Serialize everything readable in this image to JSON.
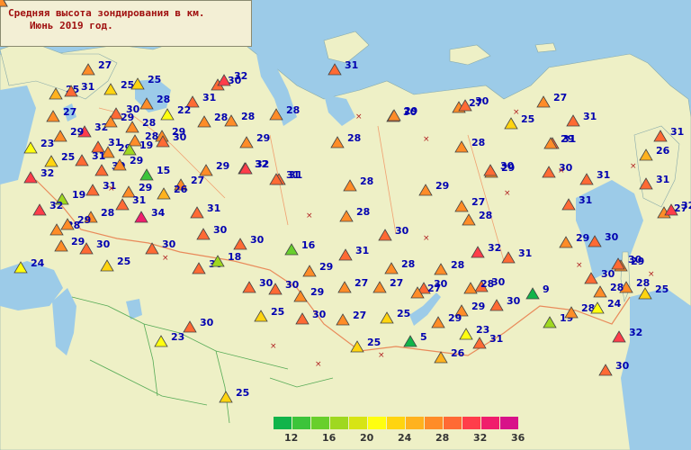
{
  "title": {
    "line1": "Средняя высота зондирования в км.",
    "line2": "Июнь 2019 год."
  },
  "colors": {
    "sea": "#9ccbe8",
    "land": "#eef0c6",
    "border": "#e98a5a",
    "label": "#0000b0"
  },
  "legend": {
    "colors": [
      "#11b44a",
      "#3cc43a",
      "#68cf2c",
      "#9fd820",
      "#d7e414",
      "#fffe10",
      "#ffd410",
      "#ffb21e",
      "#ff8c28",
      "#ff6a34",
      "#ff3d4a",
      "#f01e6c",
      "#d81289"
    ],
    "labels": [
      "12",
      "16",
      "20",
      "24",
      "28",
      "32",
      "36"
    ]
  },
  "stations": [
    {
      "v": "27",
      "c": "#ff8c28"
    },
    {
      "v": "25",
      "c": "#ffb21e"
    },
    {
      "v": "25",
      "c": "#ffd410"
    },
    {
      "v": "30",
      "c": "#ff6a34"
    },
    {
      "v": "32",
      "c": "#ff3d4a"
    },
    {
      "v": "31",
      "c": "#ff6a34"
    },
    {
      "v": "25",
      "c": "#ffd410"
    },
    {
      "v": "31",
      "c": "#ff6a34"
    },
    {
      "v": "27",
      "c": "#ff8c28"
    },
    {
      "v": "30",
      "c": "#ff6a34"
    },
    {
      "v": "28",
      "c": "#ff8c28"
    },
    {
      "v": "22",
      "c": "#fffe10"
    },
    {
      "v": "28",
      "c": "#ff8c28"
    },
    {
      "v": "28",
      "c": "#ff8c28"
    },
    {
      "v": "28",
      "c": "#ff8c28"
    },
    {
      "v": "30",
      "c": "#ff6a34"
    },
    {
      "v": "27",
      "c": "#ff8c28"
    },
    {
      "v": "32",
      "c": "#ff3d4a"
    },
    {
      "v": "29",
      "c": "#ff8c28"
    },
    {
      "v": "28",
      "c": "#ff8c28"
    },
    {
      "v": "23",
      "c": "#fffe10"
    },
    {
      "v": "31",
      "c": "#ff6a34"
    },
    {
      "v": "28",
      "c": "#ff8c28"
    },
    {
      "v": "29",
      "c": "#ff8c28"
    },
    {
      "v": "30",
      "c": "#ff6a34"
    },
    {
      "v": "29",
      "c": "#ff8c28"
    },
    {
      "v": "28",
      "c": "#ff8c28"
    },
    {
      "v": "29",
      "c": "#ff8c28"
    },
    {
      "v": "29",
      "c": "#ff8c28"
    },
    {
      "v": "19",
      "c": "#9fd820"
    },
    {
      "v": "25",
      "c": "#ffd410"
    },
    {
      "v": "31",
      "c": "#ff6a34"
    },
    {
      "v": "30",
      "c": "#ff6a34"
    },
    {
      "v": "29",
      "c": "#ff8c28"
    },
    {
      "v": "15",
      "c": "#3cc43a"
    },
    {
      "v": "32",
      "c": "#ff3d4a"
    },
    {
      "v": "29",
      "c": "#ff8c28"
    },
    {
      "v": "32",
      "c": "#ff3d4a"
    },
    {
      "v": "27",
      "c": "#ff8c28"
    },
    {
      "v": "31",
      "c": "#ff6a34"
    },
    {
      "v": "19",
      "c": "#9fd820"
    },
    {
      "v": "31",
      "c": "#ff6a34"
    },
    {
      "v": "26",
      "c": "#ffb21e"
    },
    {
      "v": "29",
      "c": "#ff8c28"
    },
    {
      "v": "28",
      "c": "#ff8c28"
    },
    {
      "v": "32",
      "c": "#ff3d4a"
    },
    {
      "v": "31",
      "c": "#ff6a34"
    },
    {
      "v": "28",
      "c": "#ff8c28"
    },
    {
      "v": "34",
      "c": "#f01e6c"
    },
    {
      "v": "29",
      "c": "#ff8c28"
    },
    {
      "v": "31",
      "c": "#ff6a34"
    },
    {
      "v": "30",
      "c": "#ff6a34"
    },
    {
      "v": "28",
      "c": "#ff8c28"
    },
    {
      "v": "29",
      "c": "#ff8c28"
    },
    {
      "v": "32",
      "c": "#ff3d4a"
    },
    {
      "v": "31",
      "c": "#ff6a34"
    },
    {
      "v": "31",
      "c": "#ff6a34"
    },
    {
      "v": "30",
      "c": "#ff6a34"
    },
    {
      "v": "29",
      "c": "#ff8c28"
    },
    {
      "v": "31",
      "c": "#ff6a34"
    },
    {
      "v": "31",
      "c": "#ff6a34"
    },
    {
      "v": "30",
      "c": "#ff6a34"
    },
    {
      "v": "16",
      "c": "#68cf2c"
    },
    {
      "v": "31",
      "c": "#ff6a34"
    },
    {
      "v": "30",
      "c": "#ff6a34"
    },
    {
      "v": "30",
      "c": "#ff6a34"
    },
    {
      "v": "32",
      "c": "#ff3d4a"
    },
    {
      "v": "30",
      "c": "#ff6a34"
    },
    {
      "v": "28",
      "c": "#ff8c28"
    },
    {
      "v": "28",
      "c": "#ff8c28"
    },
    {
      "v": "18",
      "c": "#9fd820"
    },
    {
      "v": "24",
      "c": "#fffe10"
    },
    {
      "v": "29",
      "c": "#ff8c28"
    },
    {
      "v": "25",
      "c": "#ffd410"
    },
    {
      "v": "30",
      "c": "#ff6a34"
    },
    {
      "v": "30",
      "c": "#ff6a34"
    },
    {
      "v": "28",
      "c": "#ff8c28"
    },
    {
      "v": "31",
      "c": "#ff6a34"
    },
    {
      "v": "29",
      "c": "#ff8c28"
    },
    {
      "v": "30",
      "c": "#ff6a34"
    },
    {
      "v": "27",
      "c": "#ff8c28"
    },
    {
      "v": "28",
      "c": "#ff8c28"
    },
    {
      "v": "30",
      "c": "#ff6a34"
    },
    {
      "v": "30",
      "c": "#ff6a34"
    },
    {
      "v": "30",
      "c": "#ff6a34"
    },
    {
      "v": "29",
      "c": "#ff8c28"
    },
    {
      "v": "27",
      "c": "#ff8c28"
    },
    {
      "v": "27",
      "c": "#ff8c28"
    },
    {
      "v": "28",
      "c": "#ff8c28"
    },
    {
      "v": "29",
      "c": "#ff8c28"
    },
    {
      "v": "30",
      "c": "#ff6a34"
    },
    {
      "v": "9",
      "c": "#11b44a"
    },
    {
      "v": "25",
      "c": "#ffd410"
    },
    {
      "v": "28",
      "c": "#ff8c28"
    },
    {
      "v": "30",
      "c": "#ff6a34"
    },
    {
      "v": "28",
      "c": "#ff8c28"
    },
    {
      "v": "25",
      "c": "#ffd410"
    },
    {
      "v": "30",
      "c": "#ff6a34"
    },
    {
      "v": "30",
      "c": "#ff6a34"
    },
    {
      "v": "25",
      "c": "#ffd410"
    },
    {
      "v": "29",
      "c": "#ff8c28"
    },
    {
      "v": "27",
      "c": "#ff8c28"
    },
    {
      "v": "25",
      "c": "#ffd410"
    },
    {
      "v": "5",
      "c": "#11b44a"
    },
    {
      "v": "31",
      "c": "#ff6a34"
    },
    {
      "v": "29",
      "c": "#ff8c28"
    },
    {
      "v": "23",
      "c": "#fffe10"
    },
    {
      "v": "30",
      "c": "#ff6a34"
    },
    {
      "v": "19",
      "c": "#9fd820"
    },
    {
      "v": "28",
      "c": "#ff8c28"
    },
    {
      "v": "24",
      "c": "#fffe10"
    },
    {
      "v": "23",
      "c": "#fffe10"
    },
    {
      "v": "25",
      "c": "#ffd410"
    },
    {
      "v": "26",
      "c": "#ffb21e"
    },
    {
      "v": "31",
      "c": "#ff6a34"
    },
    {
      "v": "29",
      "c": "#ff8c28"
    },
    {
      "v": "30",
      "c": "#ff6a34"
    },
    {
      "v": "27",
      "c": "#ff8c28"
    },
    {
      "v": "25",
      "c": "#ffd410"
    },
    {
      "v": "31",
      "c": "#ff6a34"
    },
    {
      "v": "28",
      "c": "#ff8c28"
    },
    {
      "v": "29",
      "c": "#ff8c28"
    },
    {
      "v": "30",
      "c": "#ff6a34"
    },
    {
      "v": "31",
      "c": "#ff6a34"
    },
    {
      "v": "27",
      "c": "#ff8c28"
    },
    {
      "v": "26",
      "c": "#ffb21e"
    },
    {
      "v": "31",
      "c": "#ff6a34"
    },
    {
      "v": "32",
      "c": "#ff3d4a"
    },
    {
      "v": "30",
      "c": "#ff6a34"
    },
    {
      "v": "32",
      "c": "#ff3d4a"
    },
    {
      "v": "29",
      "c": "#ff8c28"
    },
    {
      "v": "27",
      "c": "#ff8c28"
    },
    {
      "v": "29",
      "c": "#ff8c28"
    },
    {
      "v": "30",
      "c": "#ff6a34"
    },
    {
      "v": "31",
      "c": "#ff6a34"
    },
    {
      "v": "29",
      "c": "#ff8c28"
    },
    {
      "v": "26",
      "c": "#ffb21e"
    },
    {
      "v": "29",
      "c": "#ff8c28"
    }
  ]
}
